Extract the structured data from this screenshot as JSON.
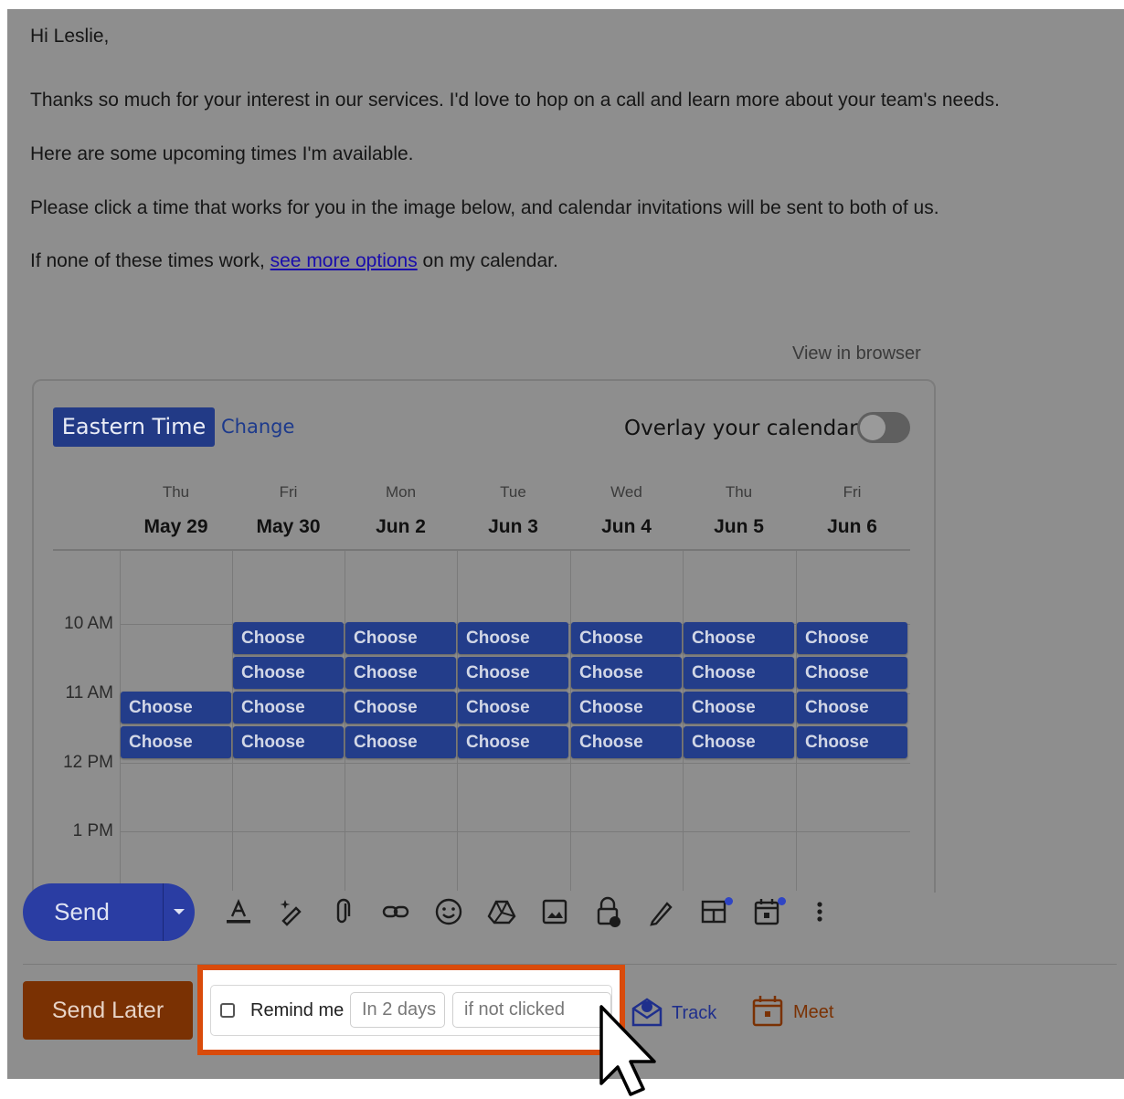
{
  "email": {
    "greeting": "Hi Leslie,",
    "paragraph1": "Thanks so much for your interest in our services. I'd love to hop on a call and learn more about your team's needs.",
    "paragraph2": "Here are some upcoming times I'm available.",
    "paragraph3": "Please click a time that works for you in the image below, and calendar invitations will be sent to both of us.",
    "paragraph4_prefix": "If none of these times work, ",
    "paragraph4_link": "see more options",
    "paragraph4_suffix": " on my calendar."
  },
  "calendar": {
    "view_in_browser": "View in browser",
    "timezone": "Eastern Time",
    "change_label": "Change",
    "overlay_label": "Overlay your calendar",
    "overlay_enabled": false,
    "days": [
      {
        "dow": "Thu",
        "date": "May 29"
      },
      {
        "dow": "Fri",
        "date": "May 30"
      },
      {
        "dow": "Mon",
        "date": "Jun 2"
      },
      {
        "dow": "Tue",
        "date": "Jun 3"
      },
      {
        "dow": "Wed",
        "date": "Jun 4"
      },
      {
        "dow": "Thu",
        "date": "Jun 5"
      },
      {
        "dow": "Fri",
        "date": "Jun 6"
      }
    ],
    "time_labels": [
      "10 AM",
      "11 AM",
      "12 PM",
      "1 PM"
    ],
    "slot_label": "Choose",
    "slots_per_day": [
      2,
      4,
      4,
      4,
      4,
      4,
      4
    ]
  },
  "compose": {
    "send_label": "Send",
    "send_later_label": "Send Later",
    "toolbar_icons": [
      "text-format-icon",
      "magic-pen-icon",
      "attach-icon",
      "link-icon",
      "emoji-icon",
      "drive-icon",
      "image-icon",
      "confidential-lock-icon",
      "signature-pen-icon",
      "layout-template-icon",
      "schedule-calendar-icon",
      "more-options-icon"
    ],
    "remind_label": "Remind me",
    "remind_delay_value": "In 2 days",
    "remind_condition_value": "if not clicked",
    "track_label": "Track",
    "meet_label": "Meet",
    "colors": {
      "accent": "#223a86",
      "send": "#2a3da3",
      "send_later": "#7a3103",
      "highlight": "#d94b0b"
    }
  }
}
